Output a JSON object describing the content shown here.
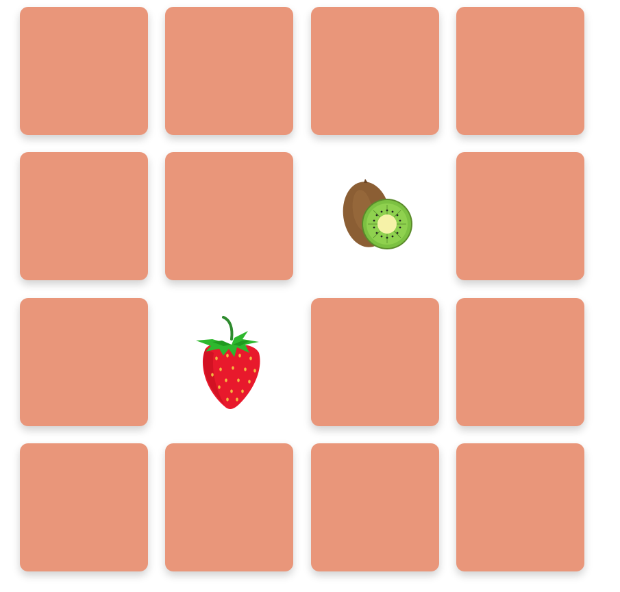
{
  "board": {
    "rows": 4,
    "cols": 4,
    "card_back_color": "#e9967a",
    "cards": [
      {
        "row": 0,
        "col": 0,
        "state": "face-down",
        "fruit": null
      },
      {
        "row": 0,
        "col": 1,
        "state": "face-down",
        "fruit": null
      },
      {
        "row": 0,
        "col": 2,
        "state": "face-down",
        "fruit": null
      },
      {
        "row": 0,
        "col": 3,
        "state": "face-down",
        "fruit": null
      },
      {
        "row": 1,
        "col": 0,
        "state": "face-down",
        "fruit": null
      },
      {
        "row": 1,
        "col": 1,
        "state": "face-down",
        "fruit": null
      },
      {
        "row": 1,
        "col": 2,
        "state": "face-up",
        "fruit": "kiwi-icon"
      },
      {
        "row": 1,
        "col": 3,
        "state": "face-down",
        "fruit": null
      },
      {
        "row": 2,
        "col": 0,
        "state": "face-down",
        "fruit": null
      },
      {
        "row": 2,
        "col": 1,
        "state": "face-up",
        "fruit": "strawberry-icon"
      },
      {
        "row": 2,
        "col": 2,
        "state": "face-down",
        "fruit": null
      },
      {
        "row": 2,
        "col": 3,
        "state": "face-down",
        "fruit": null
      },
      {
        "row": 3,
        "col": 0,
        "state": "face-down",
        "fruit": null
      },
      {
        "row": 3,
        "col": 1,
        "state": "face-down",
        "fruit": null
      },
      {
        "row": 3,
        "col": 2,
        "state": "face-down",
        "fruit": null
      },
      {
        "row": 3,
        "col": 3,
        "state": "face-down",
        "fruit": null
      }
    ]
  }
}
